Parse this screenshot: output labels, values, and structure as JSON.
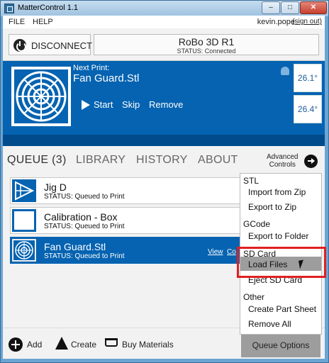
{
  "window": {
    "title": "MatterControl 1.1",
    "controls": [
      "–",
      "□",
      "✕"
    ]
  },
  "menubar": {
    "items": [
      "FILE",
      "HELP"
    ],
    "user": "kevin.pope",
    "signout": "(sign out)"
  },
  "toolbar": {
    "disconnect_label": "DISCONNECT",
    "printer_name": "RoBo 3D R1",
    "printer_status": "STATUS: Connected"
  },
  "print_panel": {
    "next_print_label": "Next Print:",
    "file_name": "Fan Guard.Stl",
    "actions": {
      "start": "Start",
      "skip": "Skip",
      "remove": "Remove"
    },
    "temps": [
      "26.1°",
      "26.4°"
    ]
  },
  "tabs": {
    "items": [
      "QUEUE (3)",
      "LIBRARY",
      "HISTORY",
      "ABOUT"
    ],
    "active": "QUEUE (3)",
    "advanced_line1": "Advanced",
    "advanced_line2": "Controls"
  },
  "queue": {
    "items": [
      {
        "name": "Jig D",
        "status": "STATUS: Queued to Print",
        "selected": false
      },
      {
        "name": "Calibration - Box",
        "status": "STATUS: Queued to Print",
        "selected": false
      },
      {
        "name": "Fan Guard.Stl",
        "status": "STATUS: Queued to Print",
        "selected": true,
        "view": "View",
        "copy": "Co"
      }
    ]
  },
  "bottombar": {
    "add": "Add",
    "create": "Create",
    "buy": "Buy Materials",
    "queue_options": "Queue Options"
  },
  "menu": {
    "stl_header": "STL",
    "import_zip": "Import from Zip",
    "export_zip": "Export to Zip",
    "gcode_header": "GCode",
    "export_folder": "Export to Folder",
    "sd_header": "SD Card",
    "load_files": "Load Files",
    "eject_sd": "Eject SD Card",
    "other_header": "Other",
    "create_sheet": "Create Part Sheet",
    "remove_all": "Remove All",
    "hovered_item": "Load Files"
  },
  "colors": {
    "accent": "#0563b1",
    "highlight": "#e02020",
    "window_border": "#6aa5d3"
  }
}
